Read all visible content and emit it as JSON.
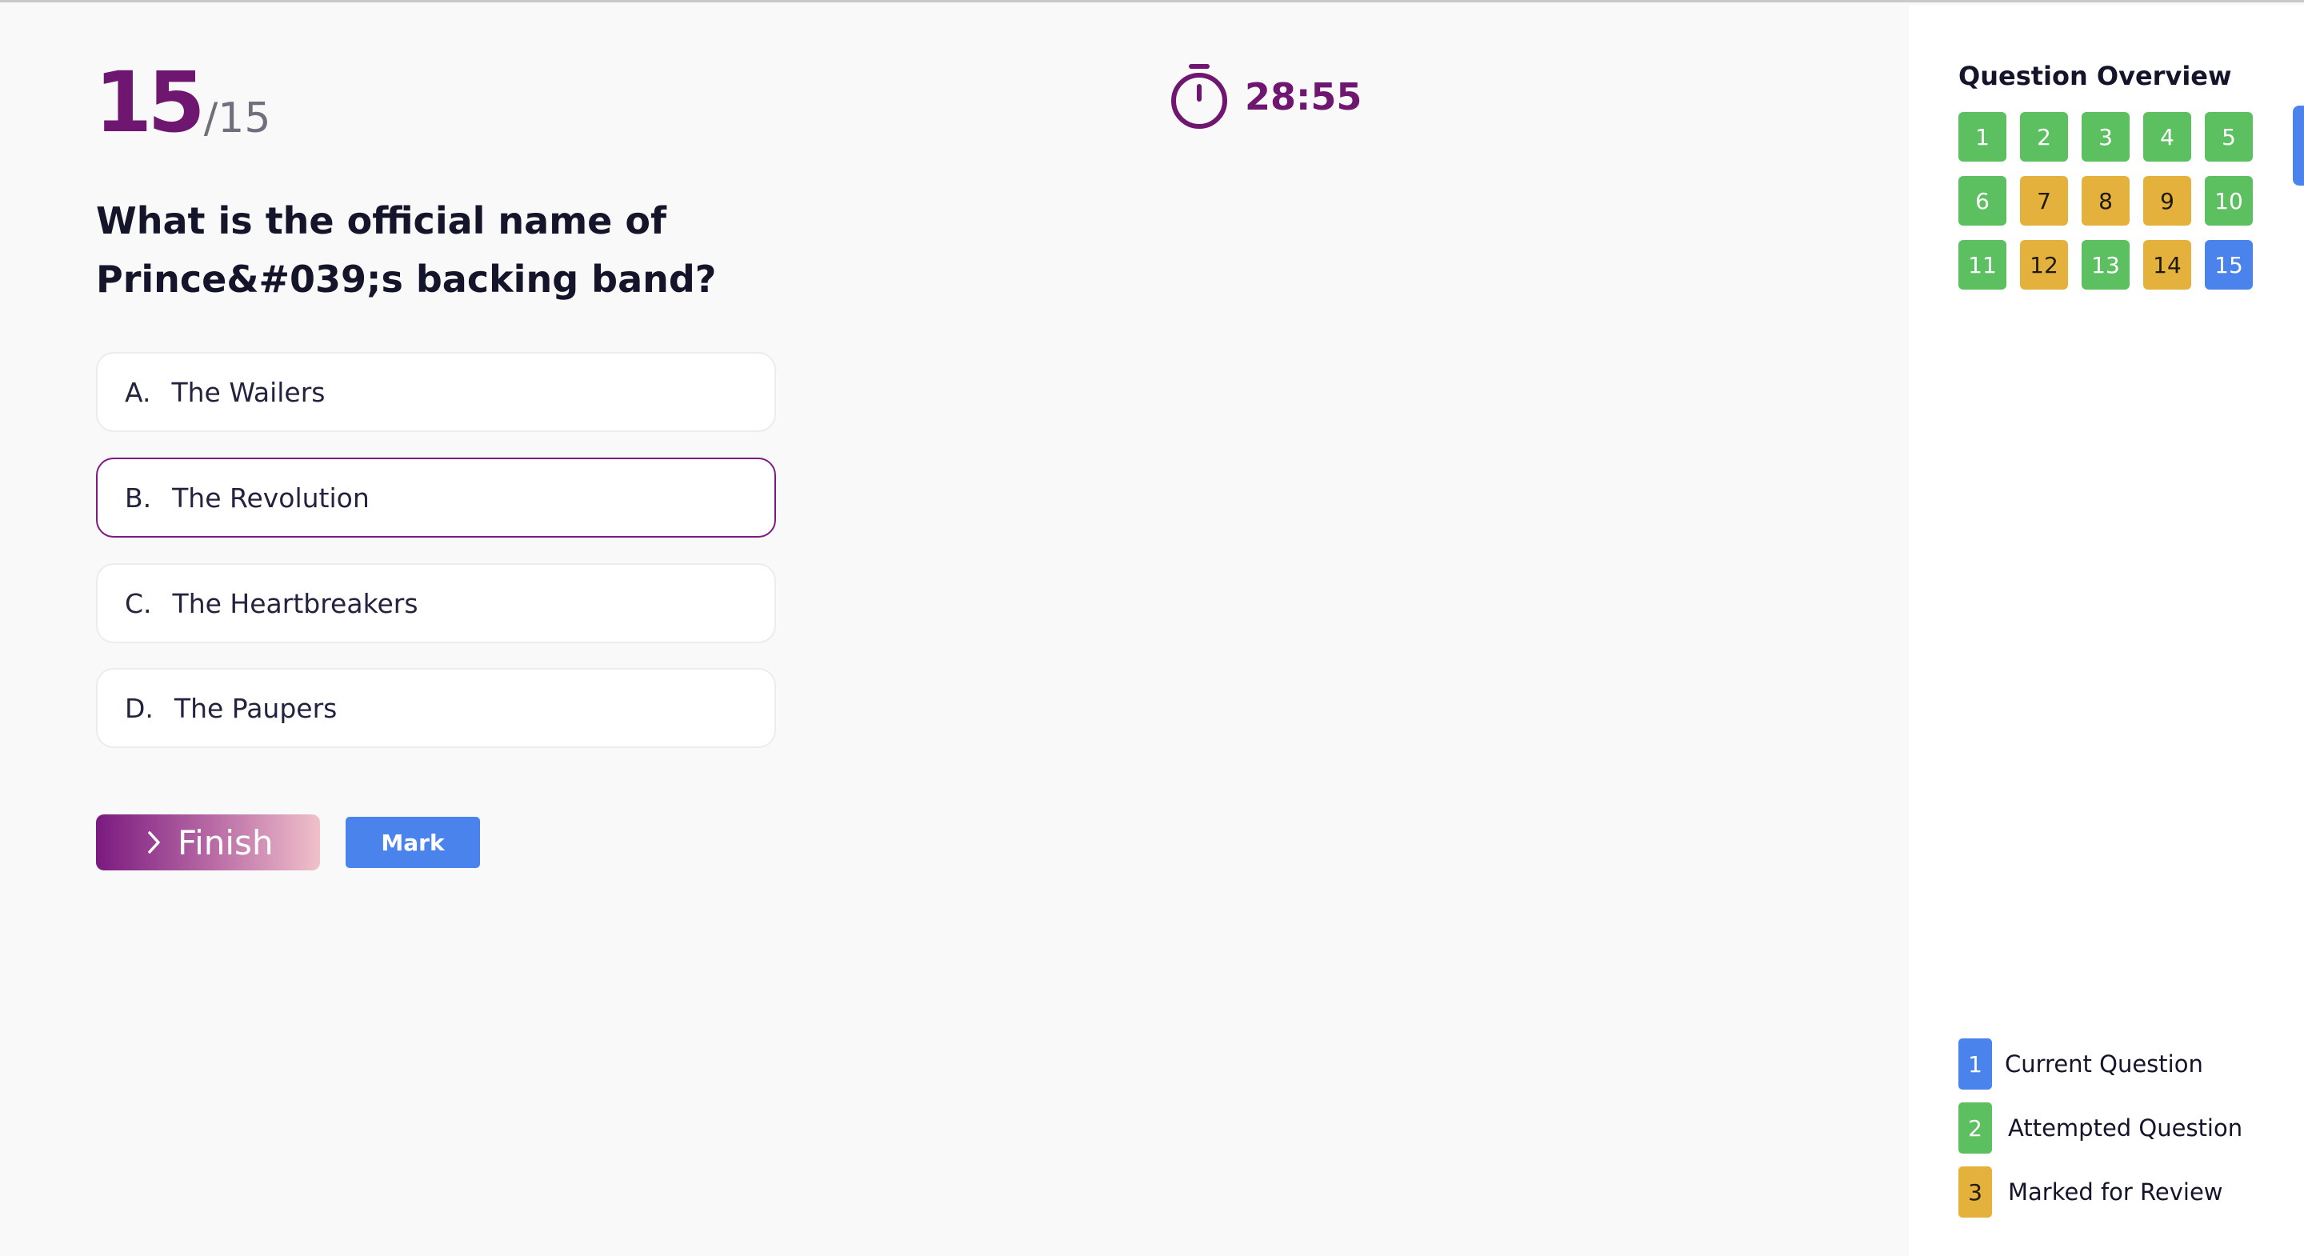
{
  "counter": {
    "current": "15",
    "total": "/15"
  },
  "timer": {
    "value": "28:55",
    "icon": "stopwatch-icon"
  },
  "question": {
    "text": "What is the official name of Prince&#039;s backing band?"
  },
  "options": [
    {
      "letter": "A.",
      "text": "The Wailers",
      "selected": false
    },
    {
      "letter": "B.",
      "text": "The Revolution",
      "selected": true
    },
    {
      "letter": "C.",
      "text": "The Heartbreakers",
      "selected": false
    },
    {
      "letter": "D.",
      "text": "The Paupers",
      "selected": false
    }
  ],
  "actions": {
    "finish_label": "Finish",
    "mark_label": "Mark"
  },
  "overview": {
    "title": "Question Overview",
    "questions": [
      {
        "n": "1",
        "status": "attempted"
      },
      {
        "n": "2",
        "status": "attempted"
      },
      {
        "n": "3",
        "status": "attempted"
      },
      {
        "n": "4",
        "status": "attempted"
      },
      {
        "n": "5",
        "status": "attempted"
      },
      {
        "n": "6",
        "status": "attempted"
      },
      {
        "n": "7",
        "status": "marked"
      },
      {
        "n": "8",
        "status": "marked"
      },
      {
        "n": "9",
        "status": "marked"
      },
      {
        "n": "10",
        "status": "attempted"
      },
      {
        "n": "11",
        "status": "attempted"
      },
      {
        "n": "12",
        "status": "marked"
      },
      {
        "n": "13",
        "status": "attempted"
      },
      {
        "n": "14",
        "status": "marked"
      },
      {
        "n": "15",
        "status": "current"
      }
    ]
  },
  "legend": [
    {
      "n": "1",
      "label": "Current Question",
      "color": "#4b83ec"
    },
    {
      "n": "2",
      "label": "Attempted Question",
      "color": "#5cbf60"
    },
    {
      "n": "3",
      "label": "Marked for Review",
      "color": "#e4b23c"
    }
  ],
  "colors": {
    "brand": "#6e1670",
    "current": "#4b83ec",
    "attempted": "#5cbf60",
    "marked": "#e4b23c"
  }
}
